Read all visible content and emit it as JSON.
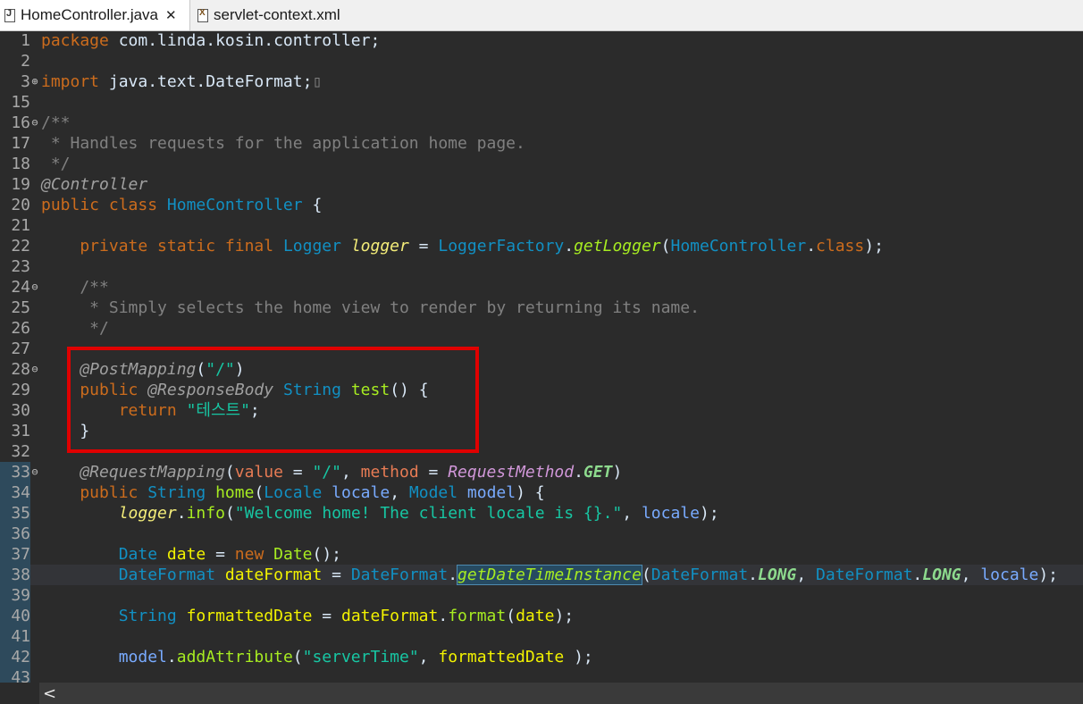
{
  "tabs": [
    {
      "label": "HomeController.java",
      "close": "✕"
    },
    {
      "label": "servlet-context.xml"
    }
  ],
  "fold_marker": "⊖",
  "lines": [
    {
      "n": "1",
      "tokens": [
        [
          "package",
          "kw"
        ],
        [
          " com.linda.kosin.controller;",
          "pl"
        ]
      ]
    },
    {
      "n": "2",
      "tokens": []
    },
    {
      "n": "3",
      "fold": "⊕",
      "tokens": [
        [
          "import",
          "kw"
        ],
        [
          " java.text.DateFormat;",
          "pl"
        ],
        [
          "▯",
          "cm"
        ]
      ]
    },
    {
      "n": "15",
      "tokens": []
    },
    {
      "n": "16",
      "fold": "⊖",
      "tokens": [
        [
          "/**",
          "cm"
        ]
      ]
    },
    {
      "n": "17",
      "tokens": [
        [
          " * Handles requests for the application home page.",
          "cm"
        ]
      ]
    },
    {
      "n": "18",
      "tokens": [
        [
          " */",
          "cm"
        ]
      ]
    },
    {
      "n": "19",
      "tokens": [
        [
          "@Controller",
          "an"
        ]
      ]
    },
    {
      "n": "20",
      "tokens": [
        [
          "public class ",
          "kw"
        ],
        [
          "HomeController",
          "ty"
        ],
        [
          " {",
          "pl"
        ]
      ]
    },
    {
      "n": "21",
      "tokens": []
    },
    {
      "n": "22",
      "tokens": [
        [
          "    private static final ",
          "kw"
        ],
        [
          "Logger",
          "ty"
        ],
        [
          " ",
          "pl"
        ],
        [
          "logger",
          "fld"
        ],
        [
          " = ",
          "pl"
        ],
        [
          "LoggerFactory",
          "ty"
        ],
        [
          ".",
          "pl"
        ],
        [
          "getLogger",
          "mth"
        ],
        [
          "(",
          "pl"
        ],
        [
          "HomeController",
          "ty"
        ],
        [
          ".",
          "pl"
        ],
        [
          "class",
          "kw"
        ],
        [
          ");",
          "pl"
        ]
      ]
    },
    {
      "n": "23",
      "tokens": []
    },
    {
      "n": "24",
      "fold": "⊖",
      "tokens": [
        [
          "    /**",
          "cm"
        ]
      ]
    },
    {
      "n": "25",
      "tokens": [
        [
          "     * Simply selects the home view to render by returning its name.",
          "cm"
        ]
      ]
    },
    {
      "n": "26",
      "tokens": [
        [
          "     */",
          "cm"
        ]
      ]
    },
    {
      "n": "27",
      "tokens": []
    },
    {
      "n": "28",
      "fold": "⊖",
      "tokens": [
        [
          "    @PostMapping",
          "an"
        ],
        [
          "(",
          "pl"
        ],
        [
          "\"/\"",
          "st"
        ],
        [
          ")",
          "pl"
        ]
      ]
    },
    {
      "n": "29",
      "tokens": [
        [
          "    public ",
          "kw"
        ],
        [
          "@ResponseBody",
          "an"
        ],
        [
          " ",
          "pl"
        ],
        [
          "String",
          "ty"
        ],
        [
          " ",
          "pl"
        ],
        [
          "test",
          "mcall"
        ],
        [
          "() {",
          "pl"
        ]
      ]
    },
    {
      "n": "30",
      "tokens": [
        [
          "        return ",
          "kw"
        ],
        [
          "\"테스트\"",
          "st"
        ],
        [
          ";",
          "pl"
        ]
      ]
    },
    {
      "n": "31",
      "tokens": [
        [
          "    }",
          "pl"
        ]
      ]
    },
    {
      "n": "32",
      "tokens": []
    },
    {
      "n": "33",
      "fold": "⊖",
      "mark": true,
      "tokens": [
        [
          "    @RequestMapping",
          "an"
        ],
        [
          "(",
          "pl"
        ],
        [
          "value",
          "attr"
        ],
        [
          " = ",
          "pl"
        ],
        [
          "\"/\"",
          "st"
        ],
        [
          ", ",
          "pl"
        ],
        [
          "method",
          "attr"
        ],
        [
          " = ",
          "pl"
        ],
        [
          "RequestMethod",
          "an2"
        ],
        [
          ".",
          "pl"
        ],
        [
          "GET",
          "stf"
        ],
        [
          ")",
          "pl"
        ]
      ]
    },
    {
      "n": "34",
      "mark": true,
      "tokens": [
        [
          "    public ",
          "kw"
        ],
        [
          "String",
          "ty"
        ],
        [
          " ",
          "pl"
        ],
        [
          "home",
          "mcall"
        ],
        [
          "(",
          "pl"
        ],
        [
          "Locale",
          "ty"
        ],
        [
          " ",
          "pl"
        ],
        [
          "locale",
          "prm"
        ],
        [
          ", ",
          "pl"
        ],
        [
          "Model",
          "ty"
        ],
        [
          " ",
          "pl"
        ],
        [
          "model",
          "prm"
        ],
        [
          ") {",
          "pl"
        ]
      ]
    },
    {
      "n": "35",
      "mark": true,
      "tokens": [
        [
          "        ",
          "pl"
        ],
        [
          "logger",
          "fld"
        ],
        [
          ".",
          "pl"
        ],
        [
          "info",
          "mcall"
        ],
        [
          "(",
          "pl"
        ],
        [
          "\"Welcome home! The client locale is {}.\"",
          "st"
        ],
        [
          ", ",
          "pl"
        ],
        [
          "locale",
          "prm"
        ],
        [
          ");",
          "pl"
        ]
      ]
    },
    {
      "n": "36",
      "mark": true,
      "tokens": []
    },
    {
      "n": "37",
      "mark": true,
      "tokens": [
        [
          "        ",
          "pl"
        ],
        [
          "Date",
          "ty"
        ],
        [
          " ",
          "pl"
        ],
        [
          "date",
          "var"
        ],
        [
          " = ",
          "pl"
        ],
        [
          "new",
          "kw"
        ],
        [
          " ",
          "pl"
        ],
        [
          "Date",
          "mcall"
        ],
        [
          "();",
          "pl"
        ]
      ]
    },
    {
      "n": "38",
      "mark": true,
      "current": true,
      "tokens": [
        [
          "        ",
          "pl"
        ],
        [
          "DateFormat",
          "ty"
        ],
        [
          " ",
          "pl"
        ],
        [
          "dateFormat",
          "var"
        ],
        [
          " = ",
          "pl"
        ],
        [
          "DateFormat",
          "ty"
        ],
        [
          ".",
          "pl"
        ],
        [
          "getDateTimeInstance",
          "mth occ"
        ],
        [
          "(",
          "pl"
        ],
        [
          "DateFormat",
          "ty"
        ],
        [
          ".",
          "pl"
        ],
        [
          "LONG",
          "stf"
        ],
        [
          ", ",
          "pl"
        ],
        [
          "DateFormat",
          "ty"
        ],
        [
          ".",
          "pl"
        ],
        [
          "LONG",
          "stf"
        ],
        [
          ", ",
          "pl"
        ],
        [
          "locale",
          "prm"
        ],
        [
          ");",
          "pl"
        ]
      ]
    },
    {
      "n": "39",
      "mark": true,
      "tokens": []
    },
    {
      "n": "40",
      "mark": true,
      "tokens": [
        [
          "        ",
          "pl"
        ],
        [
          "String",
          "ty"
        ],
        [
          " ",
          "pl"
        ],
        [
          "formattedDate",
          "var"
        ],
        [
          " = ",
          "pl"
        ],
        [
          "dateFormat",
          "var"
        ],
        [
          ".",
          "pl"
        ],
        [
          "format",
          "mcall"
        ],
        [
          "(",
          "pl"
        ],
        [
          "date",
          "var"
        ],
        [
          ");",
          "pl"
        ]
      ]
    },
    {
      "n": "41",
      "mark": true,
      "tokens": []
    },
    {
      "n": "42",
      "mark": true,
      "tokens": [
        [
          "        ",
          "pl"
        ],
        [
          "model",
          "prm"
        ],
        [
          ".",
          "pl"
        ],
        [
          "addAttribute",
          "mcall"
        ],
        [
          "(",
          "pl"
        ],
        [
          "\"serverTime\"",
          "st"
        ],
        [
          ", ",
          "pl"
        ],
        [
          "formattedDate",
          "var"
        ],
        [
          " );",
          "pl"
        ]
      ]
    },
    {
      "n": "43",
      "mark": true,
      "tokens": []
    }
  ],
  "scroll_left_glyph": "<"
}
